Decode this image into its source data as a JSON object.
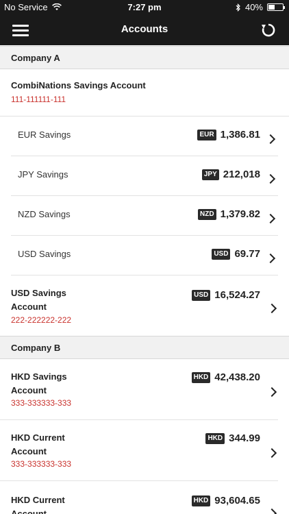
{
  "status_bar": {
    "carrier": "No Service",
    "time": "7:27 pm",
    "battery": "40%"
  },
  "header": {
    "title": "Accounts"
  },
  "company_a": {
    "title": "Company A",
    "main_account": {
      "name": "CombiNations Savings Account",
      "number": "111-111111-111"
    },
    "sub_accounts": [
      {
        "name": "EUR Savings",
        "currency": "EUR",
        "amount": "1,386.81"
      },
      {
        "name": "JPY Savings",
        "currency": "JPY",
        "amount": "212,018"
      },
      {
        "name": "NZD Savings",
        "currency": "NZD",
        "amount": "1,379.82"
      },
      {
        "name": "USD Savings",
        "currency": "USD",
        "amount": "69.77"
      }
    ],
    "usd_account": {
      "name_line1": "USD Savings",
      "name_line2": "Account",
      "number": "222-222222-222",
      "currency": "USD",
      "amount": "16,524.27"
    }
  },
  "company_b": {
    "title": "Company B",
    "accounts": [
      {
        "name_line1": "HKD Savings",
        "name_line2": "Account",
        "number": "333-333333-333",
        "currency": "HKD",
        "amount": "42,438.20"
      },
      {
        "name_line1": "HKD Current",
        "name_line2": "Account",
        "number": "333-333333-333",
        "currency": "HKD",
        "amount": "344.99"
      },
      {
        "name_line1": "HKD Current",
        "name_line2": "Account",
        "currency": "HKD",
        "amount": "93,604.65"
      }
    ]
  }
}
